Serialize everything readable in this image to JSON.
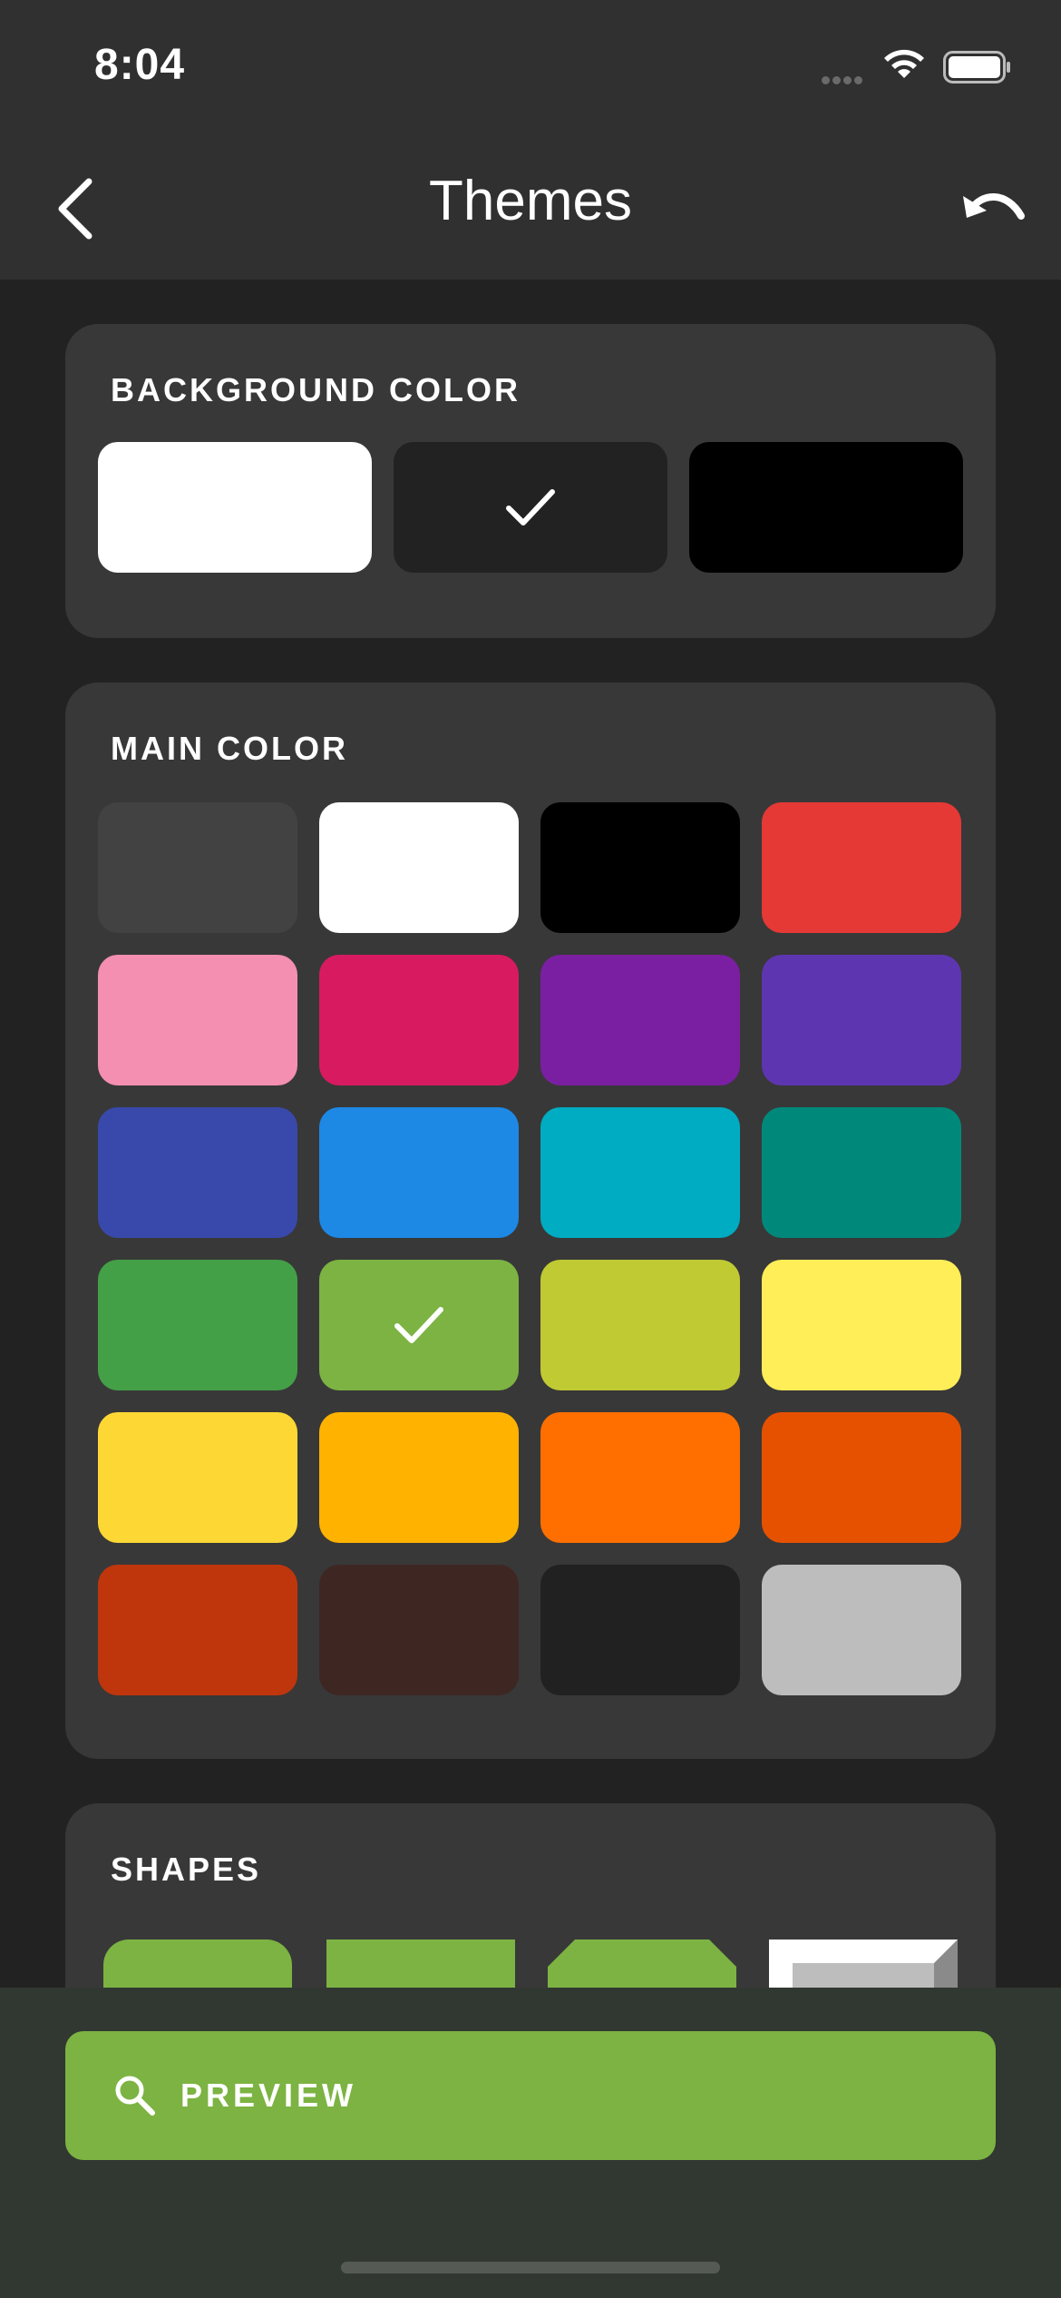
{
  "status": {
    "time": "8:04",
    "icons": [
      "signal-icon",
      "wifi-icon",
      "battery-icon"
    ]
  },
  "nav": {
    "title": "Themes",
    "back_icon": "chevron-left-icon",
    "undo_icon": "undo-icon"
  },
  "background_color": {
    "title": "BACKGROUND COLOR",
    "options": [
      {
        "color": "#ffffff",
        "selected": false
      },
      {
        "color": "#222222",
        "selected": true
      },
      {
        "color": "#000000",
        "selected": false
      }
    ]
  },
  "main_color": {
    "title": "MAIN COLOR",
    "options": [
      {
        "color": "#424242",
        "selected": false
      },
      {
        "color": "#ffffff",
        "selected": false
      },
      {
        "color": "#000000",
        "selected": false
      },
      {
        "color": "#e53935",
        "selected": false
      },
      {
        "color": "#f48fb1",
        "selected": false
      },
      {
        "color": "#d81b60",
        "selected": false
      },
      {
        "color": "#7b1fa2",
        "selected": false
      },
      {
        "color": "#5e35b1",
        "selected": false
      },
      {
        "color": "#3949ab",
        "selected": false
      },
      {
        "color": "#1e88e5",
        "selected": false
      },
      {
        "color": "#00acc1",
        "selected": false
      },
      {
        "color": "#00897b",
        "selected": false
      },
      {
        "color": "#43a047",
        "selected": false
      },
      {
        "color": "#7cb342",
        "selected": true
      },
      {
        "color": "#c0ca33",
        "selected": false
      },
      {
        "color": "#ffee58",
        "selected": false
      },
      {
        "color": "#fdd835",
        "selected": false
      },
      {
        "color": "#ffb300",
        "selected": false
      },
      {
        "color": "#ff6f00",
        "selected": false
      },
      {
        "color": "#e65100",
        "selected": false
      },
      {
        "color": "#bf360c",
        "selected": false
      },
      {
        "color": "#3e2723",
        "selected": false
      },
      {
        "color": "#212121",
        "selected": false
      },
      {
        "color": "#bdbdbd",
        "selected": false
      }
    ]
  },
  "shapes": {
    "title": "SHAPES",
    "options": [
      "rounded",
      "square",
      "beveled",
      "3d-bevel"
    ]
  },
  "preview": {
    "label": "PREVIEW",
    "icon": "search-icon"
  },
  "accent_color": "#7cb342"
}
